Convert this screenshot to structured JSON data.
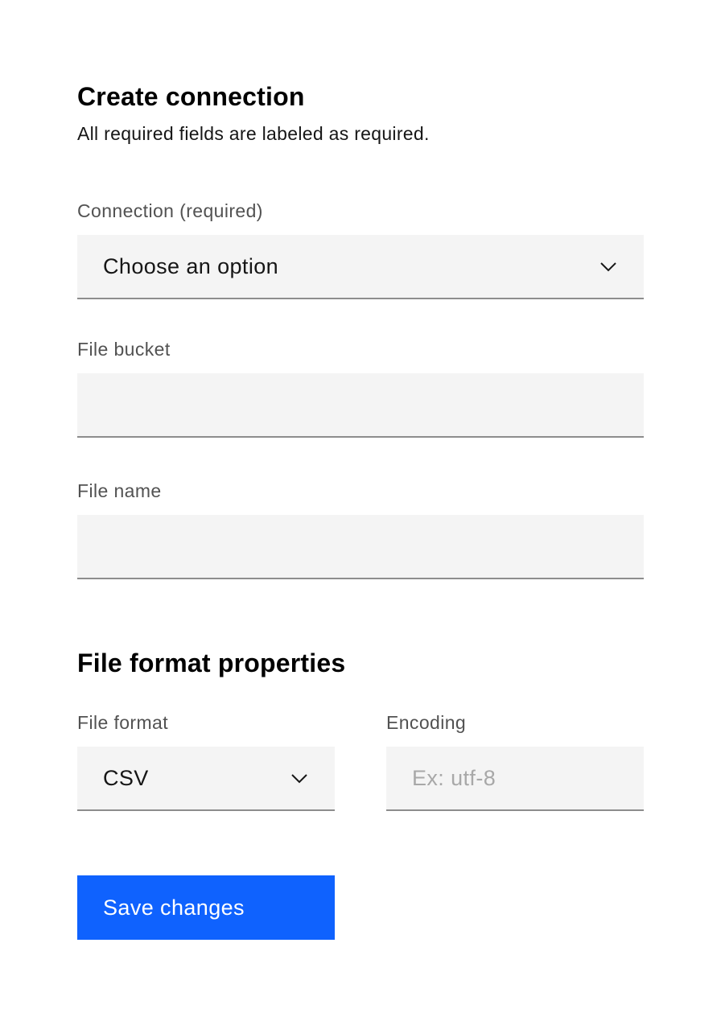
{
  "form": {
    "title": "Create connection",
    "subtitle": "All required fields are labeled as required.",
    "connection": {
      "label": "Connection (required)",
      "selected": "Choose an option",
      "icon": "chevron-down-icon"
    },
    "file_bucket": {
      "label": "File bucket",
      "value": "",
      "placeholder": ""
    },
    "file_name": {
      "label": "File name",
      "value": "",
      "placeholder": ""
    }
  },
  "file_format_section": {
    "title": "File format properties",
    "file_format": {
      "label": "File format",
      "selected": "CSV",
      "icon": "chevron-down-icon"
    },
    "encoding": {
      "label": "Encoding",
      "value": "",
      "placeholder": "Ex: utf-8"
    }
  },
  "actions": {
    "save_label": "Save changes"
  },
  "colors": {
    "primary": "#0f62fe",
    "field_background": "#f4f4f4",
    "field_border": "#8d8d8d",
    "label_text": "#525252",
    "placeholder_text": "#a8a8a8"
  }
}
